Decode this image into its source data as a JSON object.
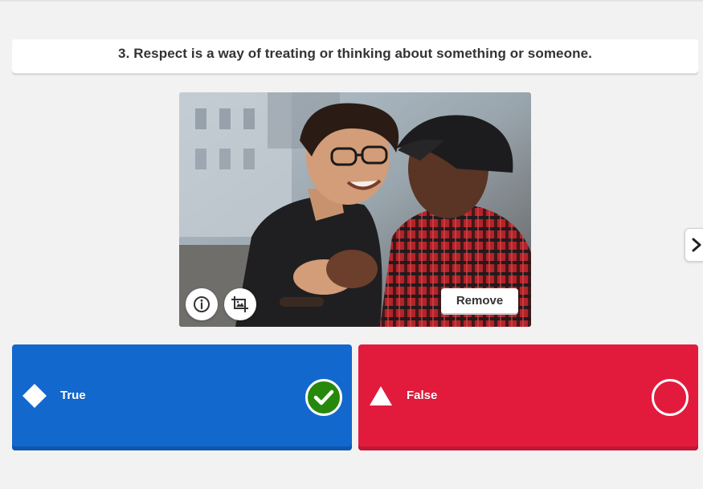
{
  "question": {
    "number": "3.",
    "text": "3. Respect is a way of treating or thinking about something or someone."
  },
  "media": {
    "remove_label": "Remove",
    "info_icon": "info-icon",
    "crop_icon": "image-crop-icon"
  },
  "answers": [
    {
      "label": "True",
      "shape": "diamond",
      "color": "#1368ce",
      "correct": true
    },
    {
      "label": "False",
      "shape": "triangle",
      "color": "#e21b3c",
      "correct": false
    }
  ],
  "colors": {
    "correct_green": "#26890c",
    "background": "#f2f2f2"
  }
}
